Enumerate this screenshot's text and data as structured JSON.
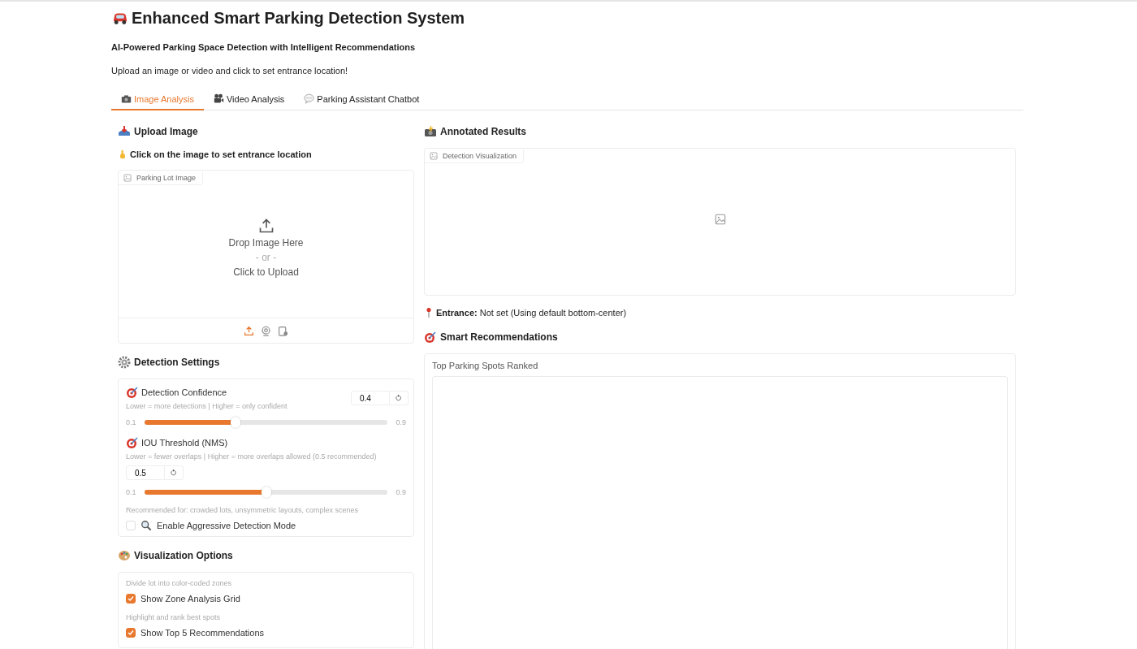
{
  "header": {
    "title": "Enhanced Smart Parking Detection System",
    "subtitle": "AI-Powered Parking Space Detection with Intelligent Recommendations",
    "instructions": "Upload an image or video and click to set entrance location!"
  },
  "tabs": [
    {
      "label": "Image Analysis",
      "kind": "camera",
      "selected": true
    },
    {
      "label": "Video Analysis",
      "kind": "film",
      "selected": false
    },
    {
      "label": "Parking Assistant Chatbot",
      "kind": "chat",
      "selected": false
    }
  ],
  "upload": {
    "heading": "Upload Image",
    "hint": "Click on the image to set entrance location",
    "label": "Parking Lot Image",
    "drop_text": "Drop Image Here",
    "or_text": "- or -",
    "click_text": "Click to Upload",
    "sources": [
      {
        "kind": "upload",
        "selected": true
      },
      {
        "kind": "webcam",
        "selected": false
      },
      {
        "kind": "clipboard",
        "selected": false
      }
    ]
  },
  "detection_settings": {
    "heading": "Detection Settings",
    "sliders": [
      {
        "kind": "inline",
        "label": "Detection Confidence",
        "info": "Lower = more detections | Higher = only confident",
        "value": "0.4",
        "min": "0.1",
        "max": "0.9",
        "level": 0.375
      },
      {
        "kind": "stacked",
        "label": "IOU Threshold (NMS)",
        "info": "Lower = fewer overlaps | Higher = more overlaps allowed (0.5 recommended)",
        "value": "0.5",
        "min": "0.1",
        "max": "0.9",
        "level": 0.5
      }
    ],
    "note": "Recommended for: crowded lots, unsymmetric layouts, complex scenes",
    "aggressive": {
      "label": "Enable Aggressive Detection Mode",
      "checked": false
    }
  },
  "visualization": {
    "heading": "Visualization Options",
    "options": [
      {
        "info": "Divide lot into color-coded zones",
        "label": "Show Zone Analysis Grid",
        "checked": true
      },
      {
        "info": "Highlight and rank best spots",
        "label": "Show Top 5 Recommendations",
        "checked": true
      }
    ]
  },
  "results": {
    "heading": "Annotated Results",
    "label": "Detection Visualization"
  },
  "entrance": {
    "label": "Entrance:",
    "value": "Not set (Using default bottom-center)"
  },
  "recommendations": {
    "heading": "Smart Recommendations",
    "label": "Top Parking Spots Ranked"
  }
}
